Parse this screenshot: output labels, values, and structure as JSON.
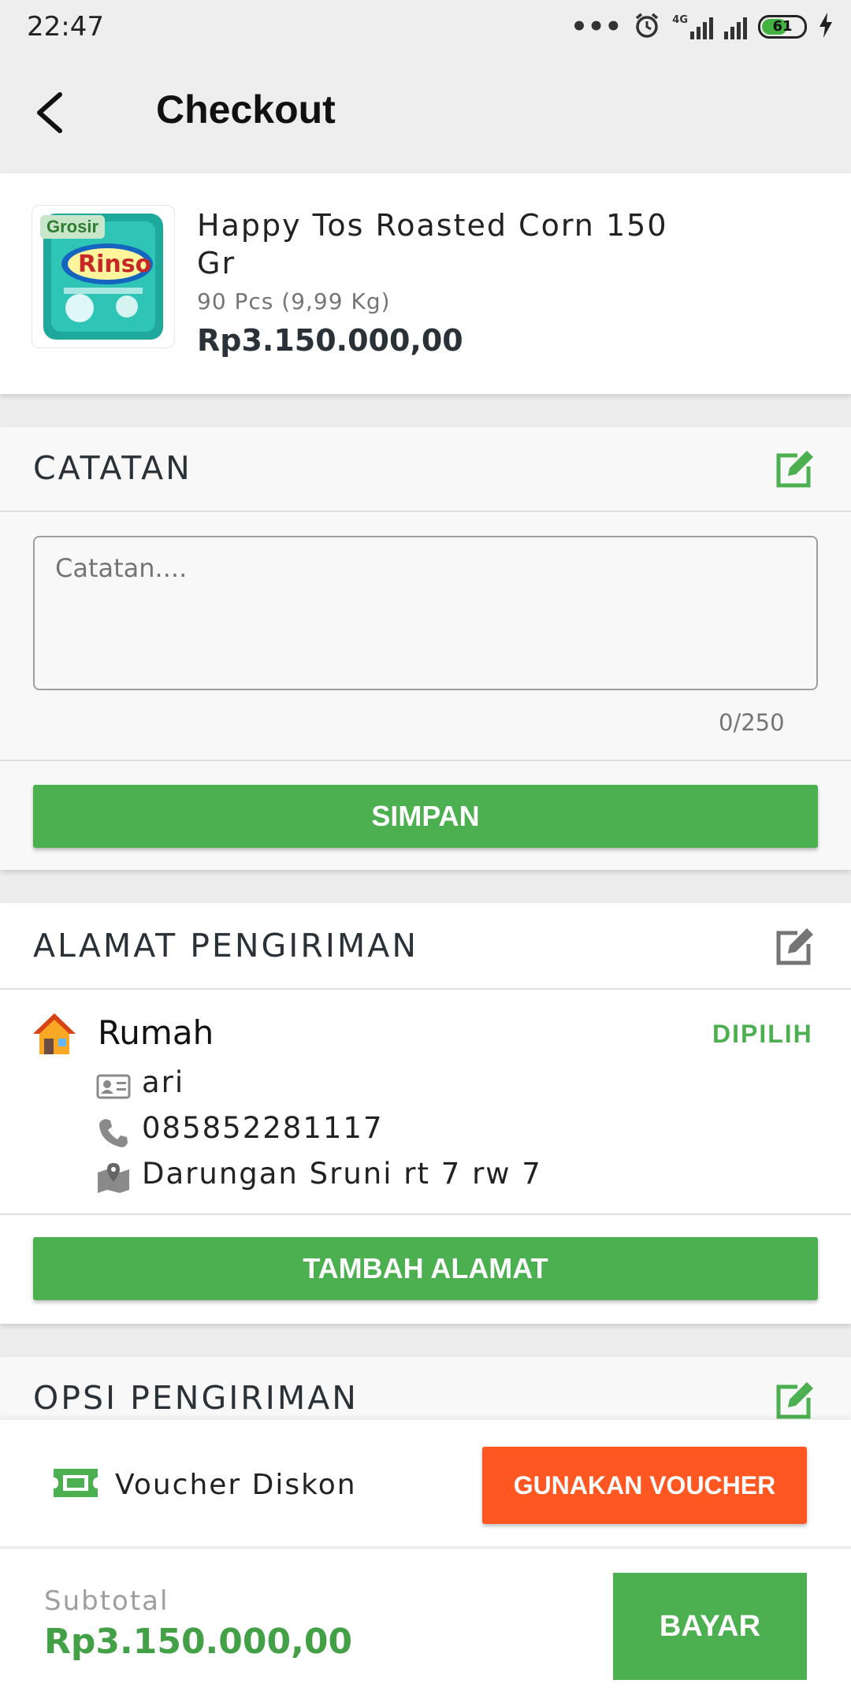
{
  "status": {
    "time": "22:47",
    "network": "4G",
    "battery": "61",
    "battery_level": 0.61
  },
  "header": {
    "title": "Checkout"
  },
  "product": {
    "badge": "Grosir",
    "name": "Happy Tos Roasted Corn 150 Gr",
    "quantity": "90 Pcs (9,99 Kg)",
    "price": "Rp3.150.000,00"
  },
  "notes": {
    "title": "CATATAN",
    "placeholder": "Catatan....",
    "counter": "0/250",
    "save_label": "SIMPAN"
  },
  "address": {
    "title": "ALAMAT PENGIRIMAN",
    "label": "Rumah",
    "status": "DIPILIH",
    "name": "ari",
    "phone": "085852281117",
    "street": "Darungan Sruni rt 7 rw 7",
    "add_label": "TAMBAH ALAMAT"
  },
  "shipping": {
    "title": "OPSI PENGIRIMAN"
  },
  "voucher": {
    "label": "Voucher Diskon",
    "button_label": "GUNAKAN VOUCHER"
  },
  "footer": {
    "subtotal_label": "Subtotal",
    "subtotal_value": "Rp3.150.000,00",
    "pay_label": "BAYAR"
  },
  "colors": {
    "primary_green": "#4caf50",
    "accent_orange": "#ff5722",
    "price_green": "#43a047"
  }
}
